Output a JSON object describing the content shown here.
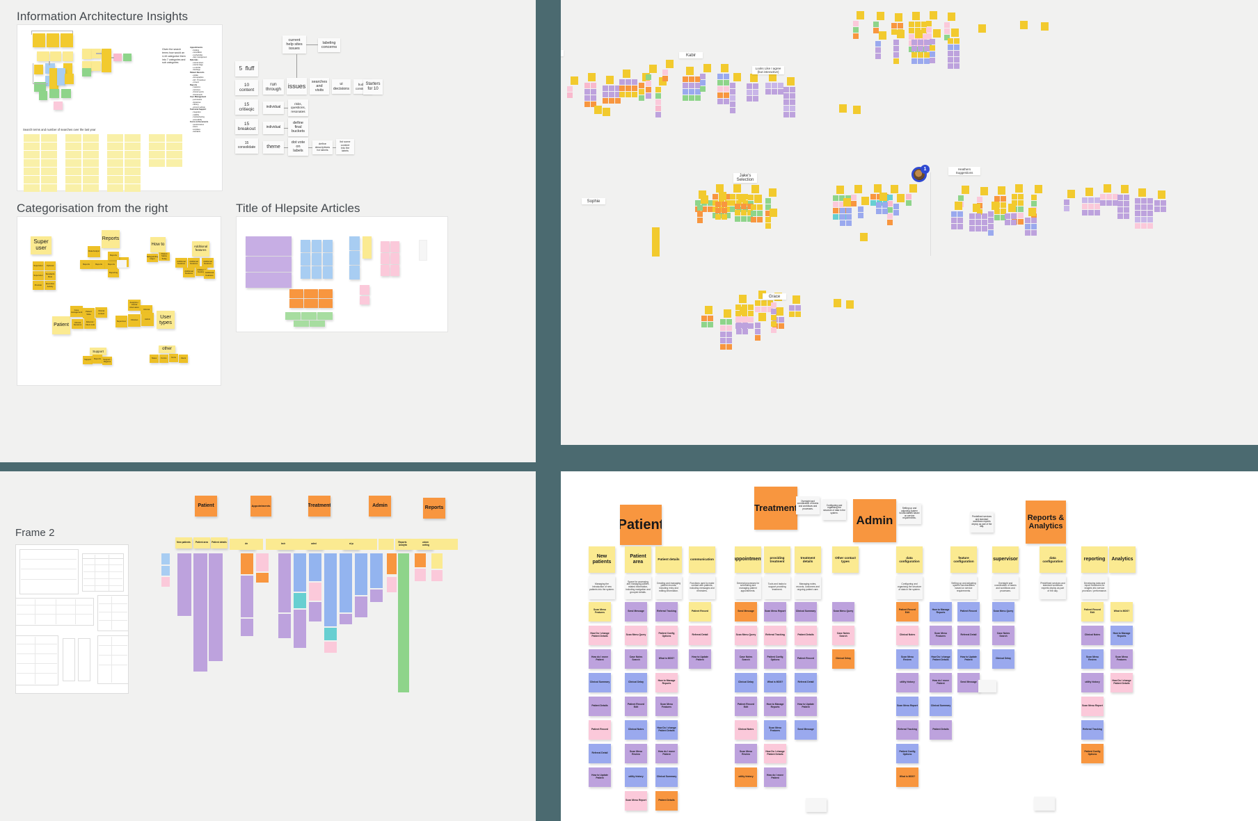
{
  "canvas": {
    "background": "#4b6a70",
    "panel_bg": "#f1f1f0"
  },
  "panels": {
    "information_architecture": {
      "title": "Information Architecture Insights",
      "prompt_note": "Given the search terms how would an LLM categorise them into 7 categories and sub categories",
      "search_caption": "Search terms and number of searches over the last year",
      "llm_categories": [
        {
          "heading": "Appointments",
          "items": [
            "booking",
            "cancellation",
            "rescheduling",
            "diary management"
          ]
        },
        {
          "heading": "Referrals",
          "items": [
            "referral letters",
            "referral triage",
            "e-referrals",
            "discharge"
          ]
        },
        {
          "heading": "Patient Records",
          "items": [
            "update",
            "demographics",
            "GP / IT handover",
            "consent"
          ]
        },
        {
          "heading": "Reports",
          "items": [
            "measures",
            "outcomes",
            "clinical reports",
            "clinical audit"
          ]
        },
        {
          "heading": "User Management",
          "items": [
            "permissions",
            "signatures",
            "training",
            "account settings"
          ]
        },
        {
          "heading": "Technical Support",
          "items": [
            "integration",
            "usability",
            "troubleshooting",
            "accessibility"
          ]
        },
        {
          "heading": "Forms & Documents",
          "items": [
            "questionnaires",
            "letters",
            "templates",
            "standards"
          ]
        }
      ]
    },
    "workshop_flow": {
      "columns": [
        {
          "time": "5",
          "label": "fluff"
        },
        {
          "time": "10",
          "label": "context"
        },
        {
          "time": "15",
          "label": "critiqic"
        },
        {
          "time": "15",
          "label": "breakout"
        },
        {
          "time": "15",
          "label": "consolidate"
        }
      ],
      "nodes": [
        "current help sites issues",
        "labeling concerns",
        "run through",
        "issues",
        "searches and visits",
        "ui decisions",
        "budget constraints",
        "Starters for 10",
        "individual",
        "risks, questions, resonates",
        "individual",
        "define final buckets",
        "theme",
        "dot vote on labels",
        "define descriptions for labels",
        "list some content into the labels"
      ]
    },
    "categorisation": {
      "title": "Categorisation from the right",
      "cluster_labels": [
        "Super user",
        "Reports",
        "How to",
        "Additional features",
        "Patient",
        "User types",
        "Support",
        "other"
      ],
      "notes": [
        "Data Analyst",
        "Reports",
        "Reports",
        "Reports",
        "Reports",
        "Reporting",
        "Issue management",
        "Patient Table",
        "Clinical contact",
        "Clinical Sessions",
        "Referral / Client Link",
        "Supervisor",
        "Clinician",
        "Admin",
        "Analytics / clinical information",
        "Support",
        "Reports",
        "Support / Regions",
        "Notes",
        "Forms",
        "Icons",
        "Users"
      ]
    },
    "helpsite": {
      "title": "Title of Hlepsite Articles"
    }
  },
  "top_right_board": {
    "labels": [
      "Alero",
      "Kabir",
      "Looks Like I agree (but interactive)",
      "Jake's Selection",
      "Heathers Suggestions",
      "Sophie",
      "Grace"
    ],
    "avatar": {
      "badge_count": "1"
    }
  },
  "bottom_left_board": {
    "frame_label": "Frame 2",
    "headers": [
      "Patient",
      "Appointments",
      "Treatment",
      "Admin",
      "Reports"
    ],
    "column_labels": [
      "New patients",
      "Patient area",
      "Patient details",
      "admin",
      "decisions",
      "admin",
      "Clinical pages",
      "Reports & Analytics",
      "Custom reporting"
    ]
  },
  "bottom_right_board": {
    "sections": [
      {
        "header": "Patient",
        "header_color": "#f8963f",
        "subheads": [
          "New patients",
          "Patient area",
          "Patient details",
          "communication"
        ],
        "descriptions": [
          "Managing the introduction of new patients into the system.",
          "Space for accessing and managing patient-related information, including navigation and grouped details.",
          "Creating and managing patient records, including entry and editing information.",
          "Functions used to make contact with patients, including messages and reminders."
        ]
      },
      {
        "header": "Treatment",
        "header_color": "#f8963f",
        "subheads": [
          "appointment",
          "providing treatment",
          "treatment details",
          "Other contact types"
        ],
        "descriptions": [
          "General processes for scheduling and managing patient appointments.",
          "Tools and tasks to support providing treatment.",
          "Managing notes, records, outcomes and ongoing patient care.",
          ""
        ]
      },
      {
        "header": "Admin",
        "header_color": "#f8963f",
        "subheads": [
          "data configuration",
          "feature configuration",
          "supervisor",
          "data configuration"
        ],
        "descriptions": [
          "Configuring and organising the structure of data in the system.",
          "Setting up and adjusting system functionalities based on service requirements.",
          "Oversight and coordination of teams and workflows and processes.",
          "Predefined services and standard workflows experts deploy as part of the day."
        ]
      },
      {
        "header": "Reports & Analytics",
        "header_color": "#f8963f",
        "subheads": [
          "reporting",
          "Analytics"
        ],
        "descriptions": [
          "Developing data and report structures for insights into service provision / performance."
        ]
      }
    ],
    "sticky_texts": [
      "Scan Menu Features",
      "How Do I change Patient Details",
      "How do I move Patient",
      "Clinical Summary",
      "Patient Details",
      "Patient Record",
      "Referral Detail",
      "How to Update Patient",
      "Send Message",
      "Scan Menu Query",
      "Case Notes Search",
      "Clinical Delay",
      "Patient Record Edit",
      "Clinical Notes",
      "Scan Menu Review",
      "utility history",
      "Scan Menu Report",
      "Referral Tracking",
      "Patient Config Options",
      "What is MDS?",
      "How to Manage Reports"
    ]
  }
}
